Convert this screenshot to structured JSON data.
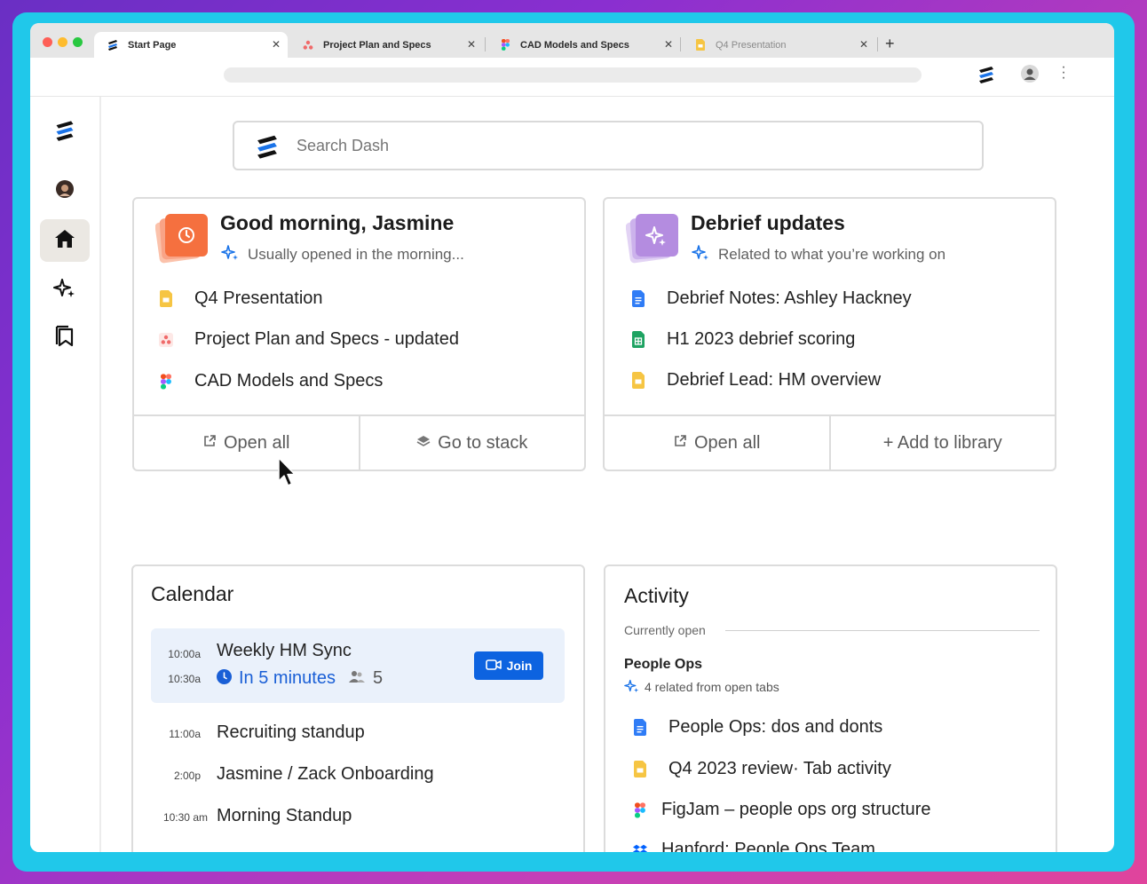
{
  "tabs": [
    {
      "label": "Start Page",
      "icon": "dash-logo-icon",
      "active": true
    },
    {
      "label": "Project Plan and Specs",
      "icon": "asana-icon"
    },
    {
      "label": "CAD Models and Specs",
      "icon": "figma-icon"
    },
    {
      "label": "Q4 Presentation",
      "icon": "slides-icon"
    }
  ],
  "search": {
    "placeholder": "Search Dash"
  },
  "morning": {
    "title": "Good morning, Jasmine",
    "subtitle": "Usually opened in the morning...",
    "items": [
      {
        "label": "Q4 Presentation",
        "icon": "slides-icon"
      },
      {
        "label": "Project Plan and Specs - updated",
        "icon": "asana-icon"
      },
      {
        "label": "CAD Models and Specs",
        "icon": "figma-icon"
      }
    ],
    "open_all": "Open all",
    "go_to_stack": "Go to stack"
  },
  "debrief": {
    "title": "Debrief updates",
    "subtitle": "Related to what you’re working on",
    "items": [
      {
        "label": "Debrief Notes: Ashley Hackney",
        "icon": "docs-icon"
      },
      {
        "label": "H1 2023 debrief scoring",
        "icon": "sheets-icon"
      },
      {
        "label": "Debrief Lead: HM overview",
        "icon": "slides-icon"
      }
    ],
    "open_all": "Open all",
    "add_to_library": "+ Add to library"
  },
  "calendar": {
    "title": "Calendar",
    "highlight": {
      "start": "10:00a",
      "end": "10:30a",
      "title": "Weekly HM Sync",
      "status": "In 5 minutes",
      "attendees": "5",
      "join": "Join"
    },
    "events": [
      {
        "time": "11:00a",
        "title": "Recruiting standup"
      },
      {
        "time": "2:00p",
        "title": "Jasmine / Zack Onboarding"
      },
      {
        "time": "10:30 am",
        "title": "Morning Standup"
      }
    ]
  },
  "activity": {
    "title": "Activity",
    "currently_open": "Currently open",
    "group": "People Ops",
    "related": "4 related from open tabs",
    "items": [
      {
        "label": "People Ops: dos and donts",
        "icon": "docs-icon"
      },
      {
        "label": "Q4 2023 review· Tab activity",
        "icon": "slides-icon"
      },
      {
        "label": "FigJam – people ops org structure",
        "icon": "figma-icon"
      },
      {
        "label": "Hanford: People Ops Team",
        "icon": "dropbox-icon"
      }
    ]
  },
  "colors": {
    "frame": "#20c8ea",
    "accent_blue": "#0d63e0",
    "morning_icon": "#f5703f",
    "debrief_icon": "#b48ce0",
    "active_sidebar": "#ebe8e3"
  }
}
